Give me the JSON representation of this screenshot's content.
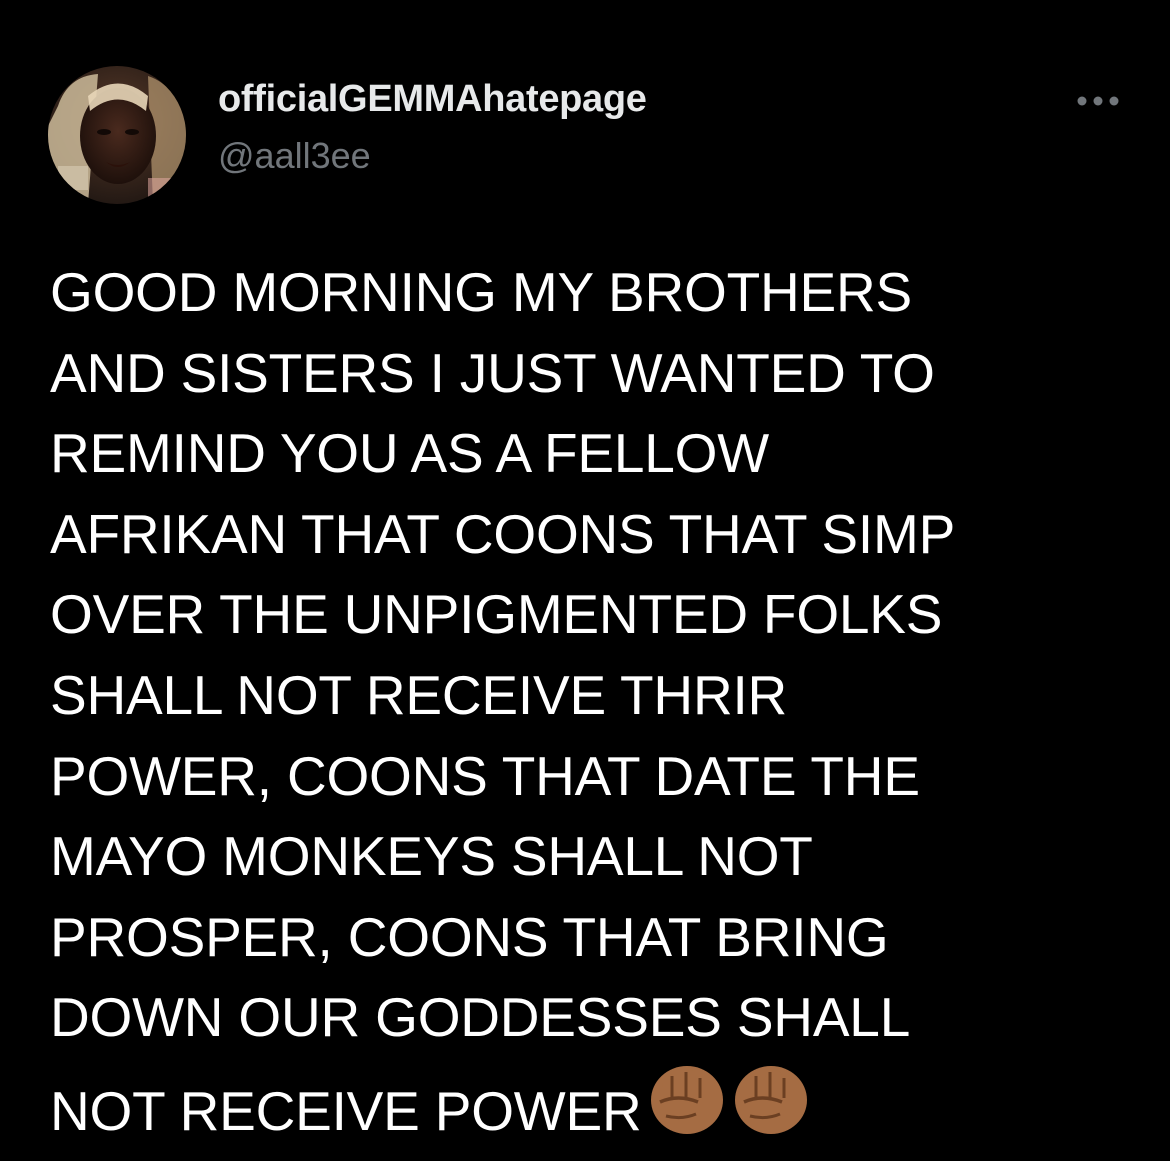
{
  "author": {
    "display_name": "officialGEMMAhatepage",
    "handle": "@aall3ee",
    "avatar_icon": "profile-photo"
  },
  "more_icon": "ellipsis-icon",
  "tweet": {
    "lines": [
      "GOOD MORNING MY BROTHERS",
      "AND SISTERS I JUST WANTED TO",
      "REMIND YOU AS A FELLOW",
      "AFRIKAN THAT COONS THAT SIMP",
      "OVER THE UNPIGMENTED FOLKS",
      "SHALL NOT RECEIVE THRIR",
      "POWER, COONS THAT DATE THE",
      "MAYO MONKEYS SHALL NOT",
      "PROSPER, COONS THAT BRING",
      "DOWN OUR GODDESSES SHALL",
      "NOT RECEIVE POWER"
    ],
    "emojis": [
      "raised-fist-medium-dark-skin",
      "raised-fist-medium-dark-skin"
    ]
  },
  "colors": {
    "background": "#000000",
    "text": "#ffffff",
    "secondary_text": "#71767b",
    "emoji_skin": "#a56c43"
  }
}
